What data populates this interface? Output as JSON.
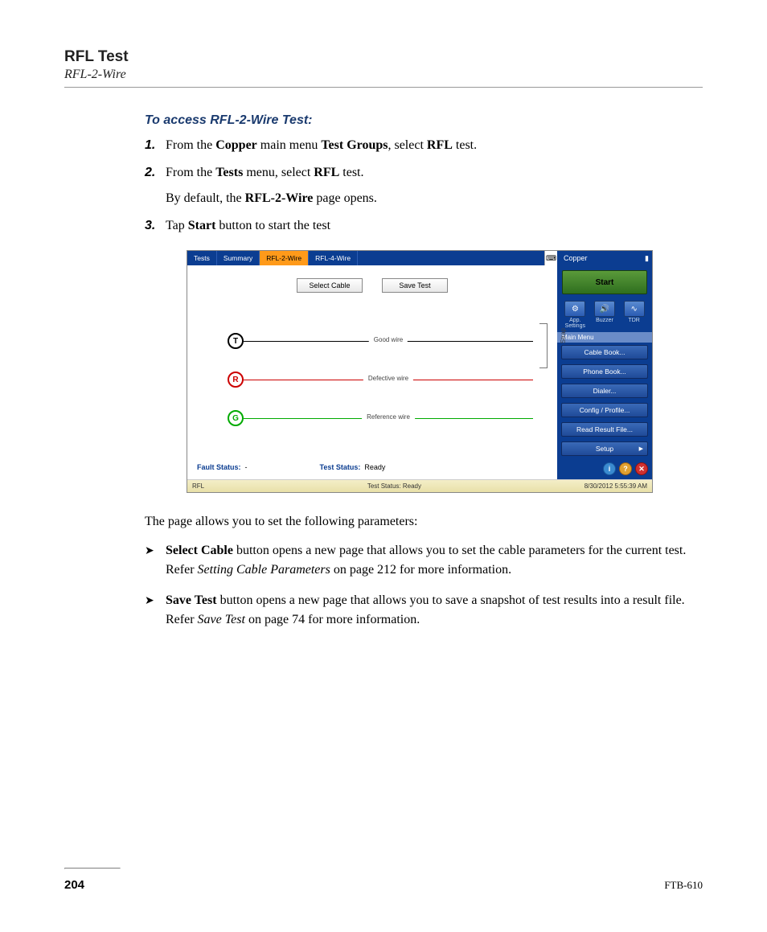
{
  "header": {
    "title": "RFL Test",
    "subtitle": "RFL-2-Wire"
  },
  "sectionHeading": "To access RFL-2-Wire Test:",
  "steps": [
    {
      "num": "1.",
      "parts": [
        "From the ",
        "Copper",
        " main menu ",
        "Test Groups",
        ", select ",
        "RFL",
        " test."
      ]
    },
    {
      "num": "2.",
      "parts": [
        "From the ",
        "Tests",
        " menu, select ",
        "RFL",
        " test."
      ],
      "sub": [
        "By default, the ",
        "RFL-2-Wire",
        " page opens."
      ]
    },
    {
      "num": "3.",
      "parts": [
        "Tap ",
        "Start",
        " button to start the test"
      ]
    }
  ],
  "screenshot": {
    "tabs": [
      "Tests",
      "Summary",
      "RFL-2-Wire",
      "RFL-4-Wire"
    ],
    "activeTabIndex": 2,
    "buttons": {
      "selectCable": "Select Cable",
      "saveTest": "Save Test"
    },
    "wires": {
      "t": {
        "letter": "T",
        "label": "Good wire"
      },
      "r": {
        "letter": "R",
        "label": "Defective wire"
      },
      "g": {
        "letter": "G",
        "label": "Reference wire"
      }
    },
    "strapLabel": "Strap",
    "faultStatusLabel": "Fault Status:",
    "faultStatusValue": "-",
    "testStatusLabel": "Test Status:",
    "testStatusValue": "Ready",
    "footer": {
      "left": "RFL",
      "center": "Test Status: Ready",
      "right": "8/30/2012 5:55:39 AM"
    },
    "side": {
      "header": "Copper",
      "start": "Start",
      "quick": [
        {
          "label": "App. Settings",
          "glyph": "⚙"
        },
        {
          "label": "Buzzer",
          "glyph": "🔊"
        },
        {
          "label": "TDR",
          "glyph": "∿"
        }
      ],
      "menuHeader": "Main Menu",
      "menuItems": [
        "Cable Book...",
        "Phone Book...",
        "Dialer...",
        "Config / Profile...",
        "Read Result File...",
        "Setup"
      ]
    }
  },
  "afterPara": "The page allows you to set the following parameters:",
  "bullets": [
    {
      "bold": "Select Cable",
      "text1": " button opens a new page that allows you to set the cable parameters for the current test. Refer ",
      "italic": "Setting Cable Parameters",
      "text2": " on page 212 for more information."
    },
    {
      "bold": "Save Test",
      "text1": " button opens a new page that allows you to save a snapshot of test results into a result file. Refer ",
      "italic": "Save Test",
      "text2": " on page 74 for more information."
    }
  ],
  "pageNumber": "204",
  "docCode": "FTB-610"
}
